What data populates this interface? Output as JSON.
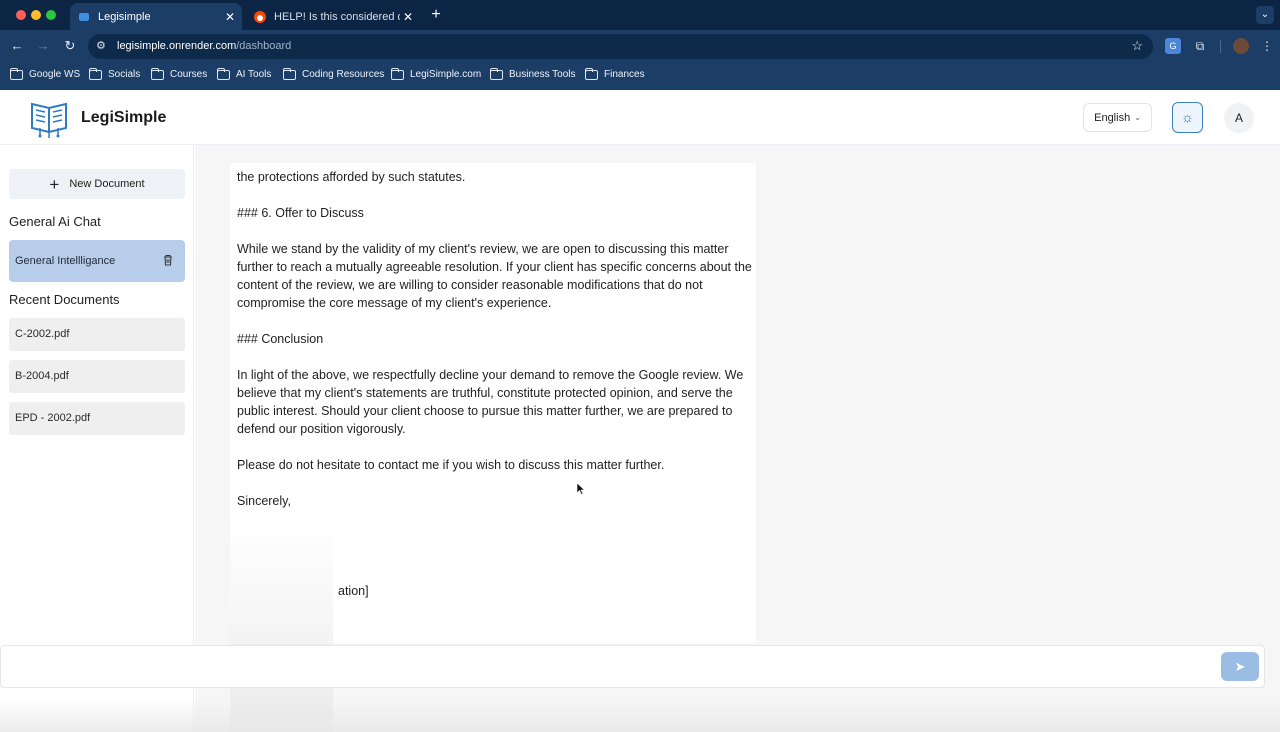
{
  "browser": {
    "tabs": [
      {
        "title": "Legisimple",
        "active": true
      },
      {
        "title": "HELP! Is this considered defa",
        "active": false
      }
    ],
    "url_host": "legisimple.onrender.com",
    "url_path": "/dashboard",
    "bookmarks": [
      "Google WS",
      "Socials",
      "Courses",
      "AI Tools",
      "Coding Resources",
      "LegiSimple.com",
      "Business Tools",
      "Finances"
    ]
  },
  "header": {
    "brand": "LegiSimple",
    "language": "English",
    "avatar_initial": "A",
    "colors": {
      "accent": "#3b82c4",
      "selected": "#b8cde9"
    }
  },
  "sidebar": {
    "new_document": "New Document",
    "general_chat_title": "General Ai Chat",
    "chat_items": [
      {
        "label": "General Intellligance"
      }
    ],
    "recent_title": "Recent Documents",
    "documents": [
      "C-2002.pdf",
      "B-2004.pdf",
      "EPD - 2002.pdf"
    ]
  },
  "letter": {
    "paragraphs": [
      "the protections afforded by such statutes.",
      "### 6. Offer to Discuss",
      "While we stand by the validity of my client's review, we are open to discussing this matter further to reach a mutually agreeable resolution. If your client has specific concerns about the content of the review, we are willing to consider reasonable modifications that do not compromise the core message of my client's experience.",
      "### Conclusion",
      "In light of the above, we respectfully decline your demand to remove the Google review. We believe that my client's statements are truthful, constitute protected opinion, and serve the public interest. Should your client choose to pursue this matter further, we are prepared to defend our position vigorously.",
      "Please do not hesitate to contact me if you wish to discuss this matter further.",
      "Sincerely,",
      "ation]"
    ]
  }
}
